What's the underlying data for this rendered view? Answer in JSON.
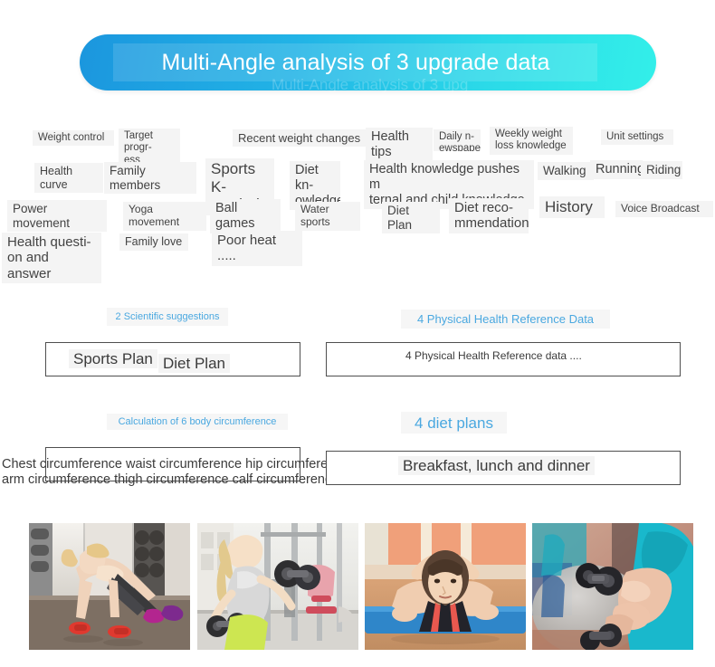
{
  "header": {
    "title": "Multi-Angle analysis of 3 upgrade data",
    "ghost_text": "Multi-Angle analysis of 3 upg",
    "gradient_start": "#1b96de",
    "gradient_end": "#33efe9",
    "title_color": "#ffffff"
  },
  "tag_cloud": {
    "tags": [
      {
        "label": "Weight control"
      },
      {
        "label": "Target progr-\ness analysis"
      },
      {
        "label": "Recent weight changes"
      },
      {
        "label": "Health tips"
      },
      {
        "label": "Daily n-\newspaper"
      },
      {
        "label": "Weekly weight\nloss knowledge"
      },
      {
        "label": "Unit settings"
      },
      {
        "label": "Health curve"
      },
      {
        "label": "Family members"
      },
      {
        "label": "Sports K-\nnowledge"
      },
      {
        "label": "Diet kn-\nowledge"
      },
      {
        "label": "Health knowledge pushes m\nternal and child knowledge"
      },
      {
        "label": "Walking"
      },
      {
        "label": "Running"
      },
      {
        "label": "Riding"
      },
      {
        "label": "Power movement"
      },
      {
        "label": "Yoga movement"
      },
      {
        "label": "Ball games"
      },
      {
        "label": "Water sports"
      },
      {
        "label": "Diet Plan"
      },
      {
        "label": "Diet reco-\nmmendation"
      },
      {
        "label": "History"
      },
      {
        "label": "Voice Broadcast"
      },
      {
        "label": "Health questi-\non and answer"
      },
      {
        "label": "Family love"
      },
      {
        "label": "Poor heat ....."
      }
    ]
  },
  "sections": {
    "scientific_suggestions": {
      "heading": "2 Scientific suggestions",
      "items": [
        {
          "label": "Sports Plan"
        },
        {
          "label": "Diet Plan"
        }
      ]
    },
    "physical_health_reference": {
      "heading": "4 Physical Health Reference Data",
      "items": [
        {
          "label": "4 Physical Health Reference data ...."
        }
      ]
    },
    "body_circumference": {
      "heading": "Calculation of 6 body circumference",
      "items": [
        {
          "label": "Chest circumference waist circumference hip circumference\narm circumference thigh circumference calf circumference"
        }
      ]
    },
    "diet_plans": {
      "heading": "4 diet plans",
      "items": [
        {
          "label": "Breakfast, lunch and dinner"
        }
      ]
    },
    "heading_color": "#4aa8e0"
  },
  "photos": [
    {
      "name": "woman-plank-with-dumbbells-gym"
    },
    {
      "name": "woman-dumbbell-raise-gym"
    },
    {
      "name": "woman-stretching-on-blue-yoga-mat"
    },
    {
      "name": "closeup-woman-bicep-curl-dumbbell"
    }
  ]
}
